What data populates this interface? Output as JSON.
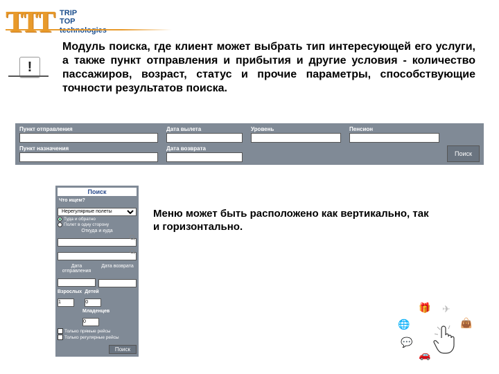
{
  "logo": {
    "ttt": "TTT",
    "line1": "TRIP",
    "line2": "TOP",
    "line3": "technologies"
  },
  "bang": "!",
  "main_text": "Модуль поиска, где клиент может выбрать тип интересующей его услуги, а также пункт отправления и прибытия и другие условия - количество пассажиров, возраст, статус и прочие параметры, способствующие точности результатов поиска.",
  "h": {
    "departure_label": "Пункт отправления",
    "destination_label": "Пункт назначения",
    "out_date_label": "Дата вылета",
    "ret_date_label": "Дата возврата",
    "level_label": "Уровень",
    "pension_label": "Пенсион",
    "search_btn": "Поиск"
  },
  "v": {
    "title": "Поиск",
    "sub_what": "Что ищем?",
    "type_value": "Нерегулярные полеты",
    "radio1": "Туда и обратно",
    "radio2": "Полет в одну сторону",
    "from_label": "Откуда и куда",
    "out_label": "Дата",
    "out_label2": "отправления",
    "ret_label": "Дата возврата",
    "adults_label": "Взрослых",
    "adults_val": "1",
    "children_label": "Детей",
    "children_val": "0",
    "infants_label": "Младенцев",
    "infants_val": "0",
    "chk1": "Только прямые рейсы",
    "chk2": "Только регулярные рейсы",
    "search_btn": "Поиск"
  },
  "side_text": "Меню может быть расположено как вертикально, так и горизонтально."
}
